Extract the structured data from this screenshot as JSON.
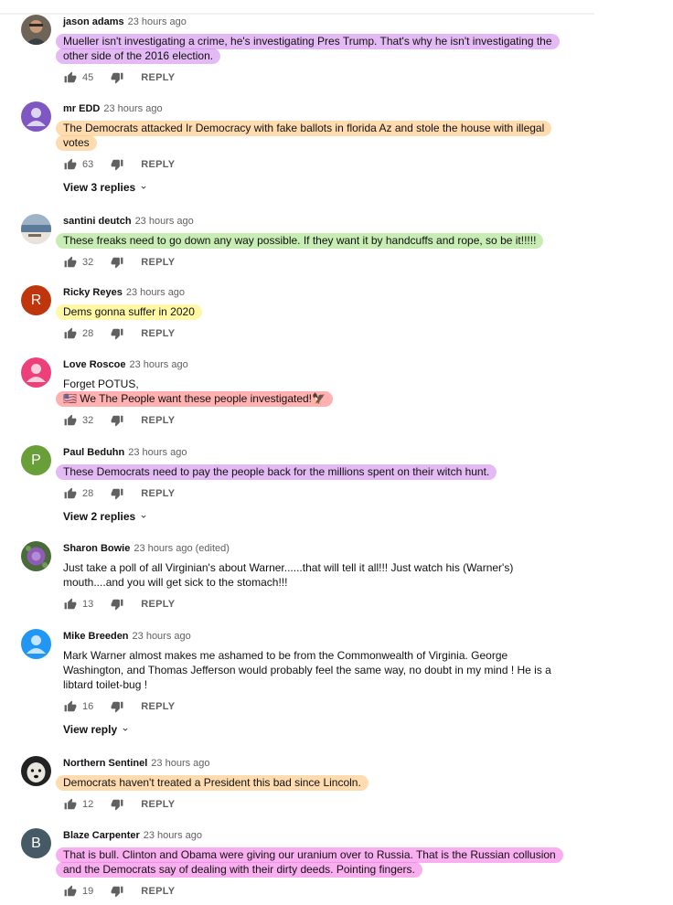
{
  "comments": [
    {
      "author": "jason adams",
      "time": "23 hours ago",
      "lines": [
        "Mueller isn't investigating a crime, he's investigating Pres Trump. That's why he isn't investigating the",
        "other side of the 2016 election."
      ],
      "likes": "45",
      "reply_label": "REPLY",
      "avatar_icon": "man-photo-icon"
    },
    {
      "author": "mr EDD",
      "time": "23 hours ago",
      "lines": [
        "The Democrats attacked Ir Democracy  with fake ballots in florida  Az and stole the house with illegal",
        "votes"
      ],
      "likes": "63",
      "reply_label": "REPLY",
      "view_replies": "View 3 replies",
      "avatar_icon": "default-person-icon",
      "avatar_color": "#7e57c2"
    },
    {
      "author": "santini deutch",
      "time": "23 hours ago",
      "lines": [
        "These freaks need to go down any way possible. If they want it by handcuffs and rope, so be it!!!!!"
      ],
      "likes": "32",
      "reply_label": "REPLY",
      "avatar_icon": "landscape-photo-icon"
    },
    {
      "author": "Ricky Reyes",
      "time": "23 hours ago",
      "lines": [
        "Dems gonna suffer in 2020"
      ],
      "likes": "28",
      "reply_label": "REPLY",
      "avatar_letter": "R",
      "avatar_color": "#bf360c"
    },
    {
      "author": "Love Roscoe",
      "time": "23 hours ago",
      "lines": [
        "Forget POTUS,",
        "🇺🇸 We The People want these people investigated!🦅"
      ],
      "likes": "32",
      "reply_label": "REPLY",
      "avatar_icon": "default-person-icon",
      "avatar_color": "#ec407a"
    },
    {
      "author": "Paul Beduhn",
      "time": "23 hours ago",
      "lines": [
        "These Democrats need to pay the people back for the millions spent on their witch hunt."
      ],
      "likes": "28",
      "reply_label": "REPLY",
      "view_replies": "View 2 replies",
      "avatar_letter": "P",
      "avatar_color": "#689f38"
    },
    {
      "author": "Sharon Bowie",
      "time": "23 hours ago (edited)",
      "lines": [
        "Just take a poll of all Virginian's about Warner......that will tell it all!!! Just watch his (Warner's)",
        "mouth....and you will get sick to the stomach!!!"
      ],
      "likes": "13",
      "reply_label": "REPLY",
      "avatar_icon": "flower-photo-icon"
    },
    {
      "author": "Mike Breeden",
      "time": "23 hours ago",
      "lines": [
        "Mark Warner almost makes me ashamed to be from the Commonwealth of Virginia. George",
        "Washington, and Thomas Jefferson would probably feel the same way, no doubt in my mind ! He is a",
        "libtard toilet-bug !"
      ],
      "likes": "16",
      "reply_label": "REPLY",
      "view_replies": "View reply",
      "avatar_icon": "default-person-icon",
      "avatar_color": "#2196f3"
    },
    {
      "author": "Northern Sentinel",
      "time": "23 hours ago",
      "lines": [
        "Democrats haven't treated a President this bad since Lincoln."
      ],
      "likes": "12",
      "reply_label": "REPLY",
      "avatar_icon": "dog-photo-icon"
    },
    {
      "author": "Blaze Carpenter",
      "time": "23 hours ago",
      "lines": [
        "That is bull.  Clinton and Obama were giving our uranium over to Russia.  That is the Russian collusion",
        "and the Democrats say of dealing with their dirty deeds.  Pointing fingers."
      ],
      "likes": "19",
      "reply_label": "REPLY",
      "avatar_letter": "B",
      "avatar_color": "#455a64"
    }
  ],
  "colors": {
    "highlight_purple": "#cd81ec",
    "highlight_orange": "#ffc885",
    "highlight_green": "#b4e69b",
    "highlight_yellow": "#fff896",
    "highlight_red": "#ff9696",
    "highlight_magenta": "#f578e6",
    "meta_text": "#606060"
  }
}
